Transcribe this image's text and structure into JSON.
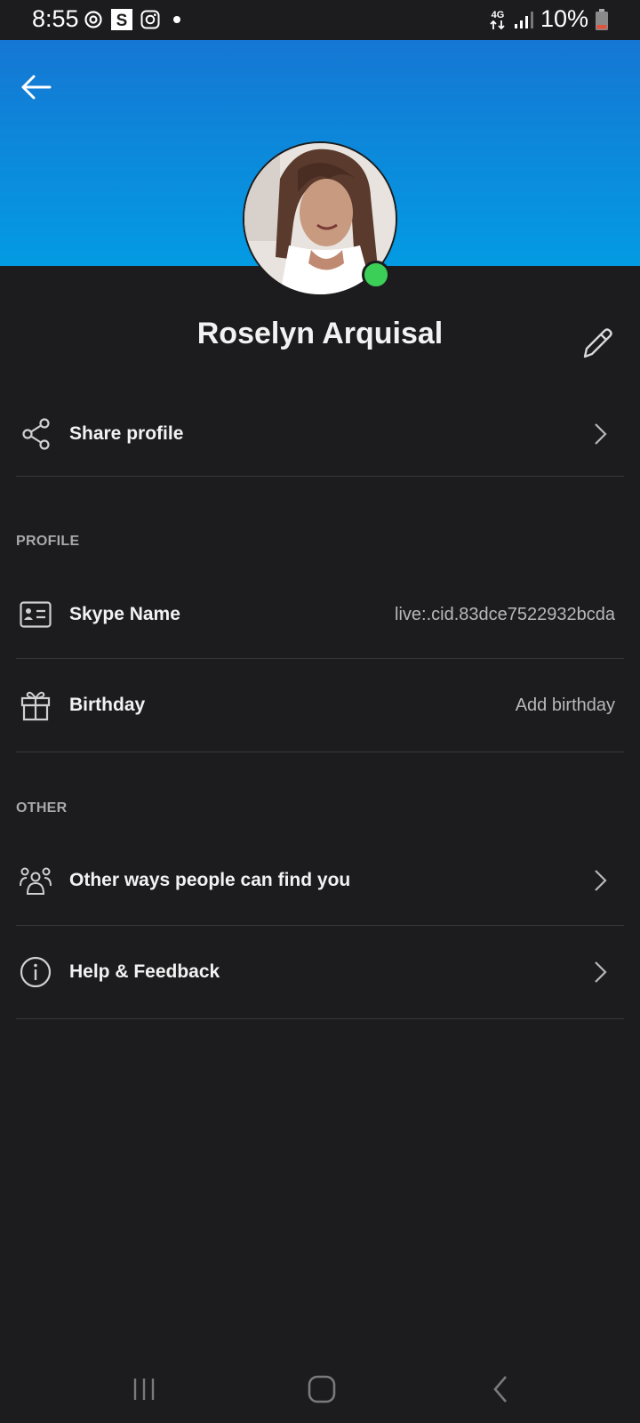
{
  "status_bar": {
    "time": "8:55",
    "network": "4G",
    "battery": "10%",
    "icons": [
      "sync-icon",
      "skype-notification-icon",
      "instagram-icon",
      "dot-icon"
    ]
  },
  "profile": {
    "name": "Roselyn Arquisal",
    "presence": "online",
    "presence_color": "#3ccf58"
  },
  "actions": {
    "share_profile": "Share profile"
  },
  "sections": {
    "profile_title": "PROFILE",
    "other_title": "OTHER"
  },
  "profile_rows": {
    "skype_name_label": "Skype Name",
    "skype_name_value": "live:.cid.83dce7522932bcda",
    "birthday_label": "Birthday",
    "birthday_value": "Add birthday"
  },
  "other_rows": {
    "find_you_label": "Other ways people can find you",
    "help_label": "Help & Feedback"
  },
  "colors": {
    "header_top": "#1577d3",
    "header_bottom": "#039be3",
    "background": "#1c1c1e"
  }
}
